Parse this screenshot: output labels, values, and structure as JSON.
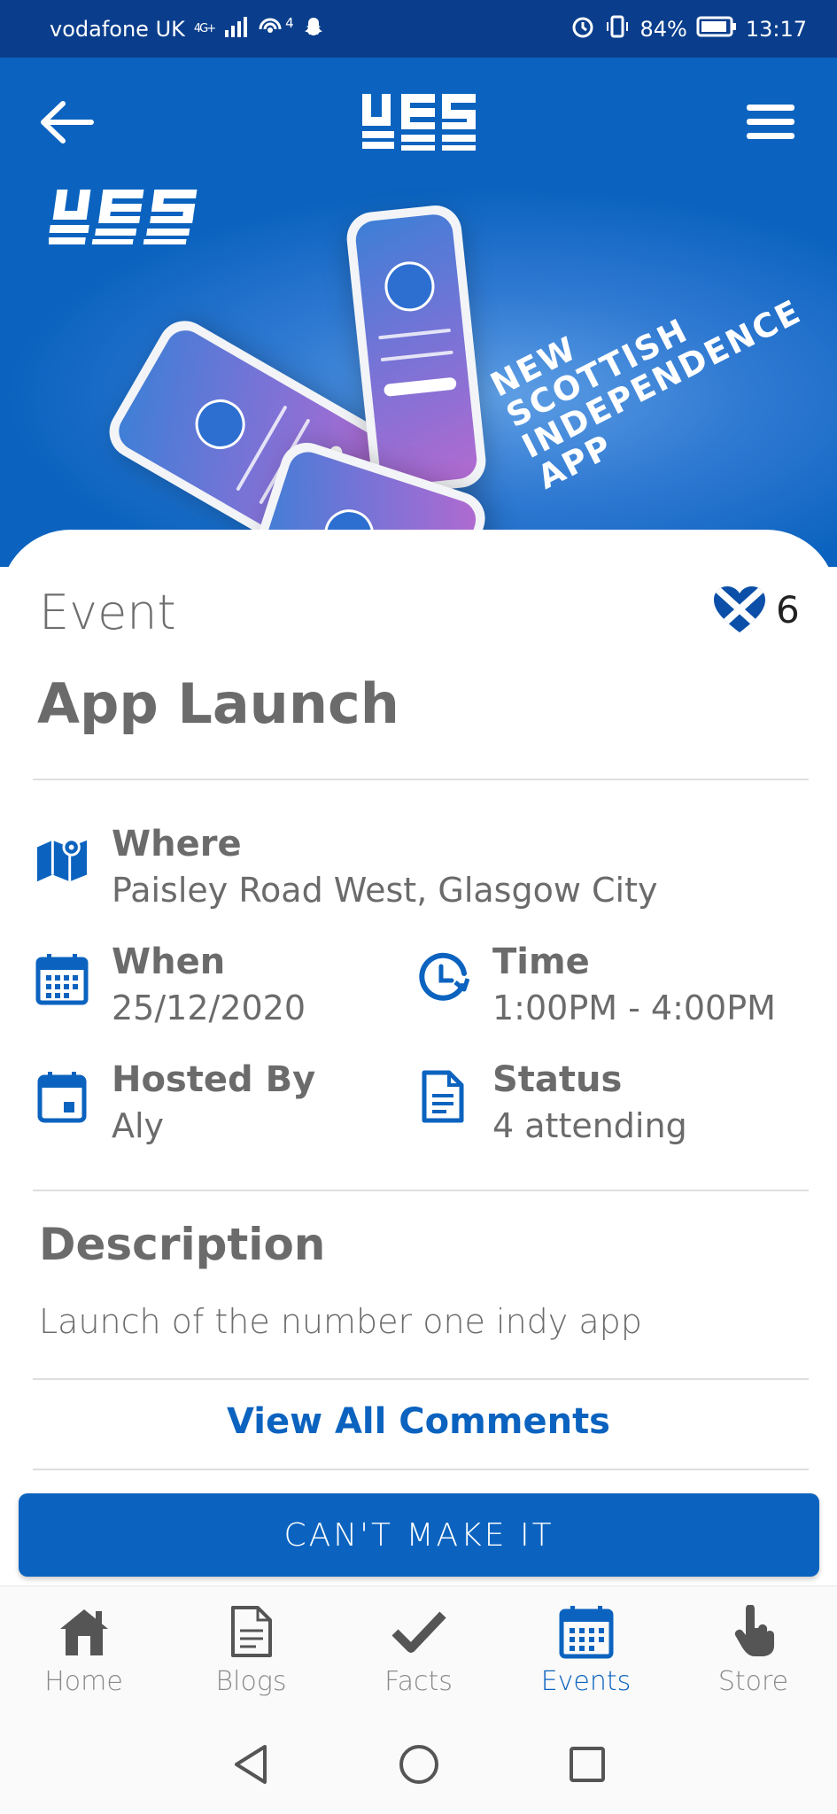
{
  "status_bar": {
    "carrier": "vodafone UK",
    "network": "4G+",
    "signal_icon": "signal-icon",
    "hotspot_badge": "4",
    "battery": "84%",
    "time": "13:17"
  },
  "header": {
    "back_icon": "arrow-left-icon",
    "menu_icon": "hamburger-menu-icon",
    "logo_text": "YES"
  },
  "banner": {
    "line1": "NEW",
    "line2": "SCOTTISH",
    "line3": "INDEPENDENCE",
    "line4": "APP"
  },
  "event": {
    "kicker": "Event",
    "title": "App Launch",
    "like_count": "6",
    "where_label": "Where",
    "where_value": "Paisley Road West, Glasgow City",
    "when_label": "When",
    "when_value": "25/12/2020",
    "time_label": "Time",
    "time_value": "1:00PM - 4:00PM",
    "hosted_label": "Hosted By",
    "hosted_value": "Aly",
    "status_label": "Status",
    "status_value": "4 attending",
    "description_heading": "Description",
    "description_text": "Launch of the number one indy app",
    "view_comments": "View All Comments",
    "cant_make_it": "CAN'T MAKE IT"
  },
  "bottom_nav": {
    "items": [
      {
        "label": "Home",
        "icon": "home-icon"
      },
      {
        "label": "Blogs",
        "icon": "document-icon"
      },
      {
        "label": "Facts",
        "icon": "checkmark-icon"
      },
      {
        "label": "Events",
        "icon": "calendar-icon"
      },
      {
        "label": "Store",
        "icon": "pointer-hand-icon"
      }
    ],
    "active": "Events"
  },
  "colors": {
    "primary": "#0b63bf",
    "status_bar": "#0a3e8c",
    "text": "#6b6b6b"
  }
}
